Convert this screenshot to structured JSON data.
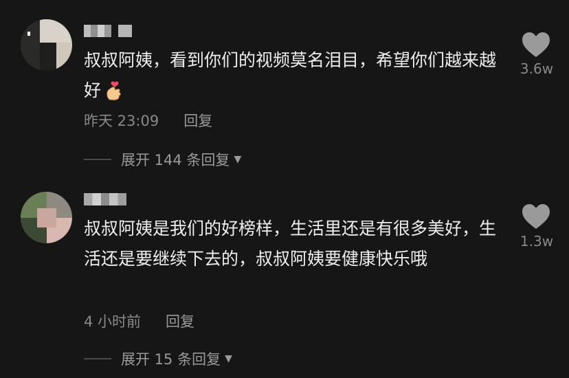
{
  "comments": [
    {
      "text": "叔叔阿姨，看到你们的视频莫名泪目，希望你们越来越好",
      "emoji": "finger-heart",
      "time": "昨天 23:09",
      "reply_label": "回复",
      "likes": "3.6w",
      "expand_label": "展开 144 条回复"
    },
    {
      "text": "叔叔阿姨是我们的好榜样，生活里还是有很多美好，生活还是要继续下去的，叔叔阿姨要健康快乐哦",
      "time": "4 小时前",
      "reply_label": "回复",
      "likes": "1.3w",
      "expand_label": "展开 15 条回复"
    }
  ],
  "icons": {
    "like": "heart-icon",
    "expand": "caret-down-icon"
  },
  "colors": {
    "background": "#161616",
    "text": "#eeeeee",
    "secondary": "#8a8a8a",
    "heart": "#9a9a9a"
  }
}
